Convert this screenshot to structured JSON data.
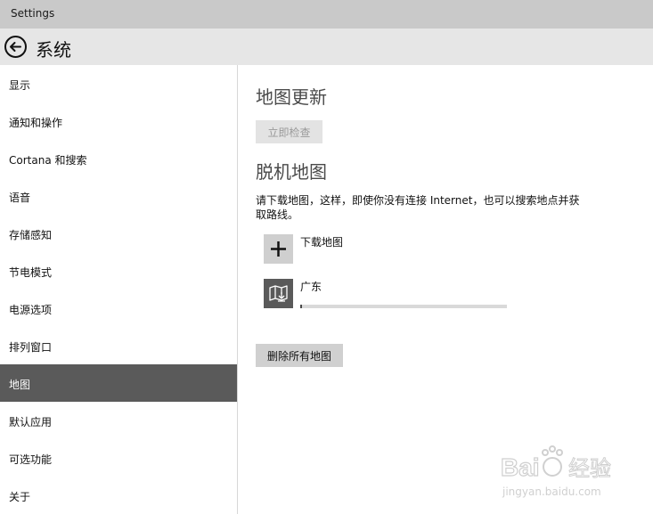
{
  "window": {
    "title": "Settings"
  },
  "header": {
    "title": "系统"
  },
  "sidebar": {
    "items": [
      {
        "label": "显示"
      },
      {
        "label": "通知和操作"
      },
      {
        "label": "Cortana 和搜索"
      },
      {
        "label": "语音"
      },
      {
        "label": "存储感知"
      },
      {
        "label": "节电模式"
      },
      {
        "label": "电源选项"
      },
      {
        "label": "排列窗口"
      },
      {
        "label": "地图",
        "selected": true
      },
      {
        "label": "默认应用"
      },
      {
        "label": "可选功能"
      },
      {
        "label": "关于"
      }
    ]
  },
  "main": {
    "map_updates": {
      "heading": "地图更新",
      "check_button": "立即检查"
    },
    "offline_maps": {
      "heading": "脱机地图",
      "description": "请下载地图，这样，即使你没有连接 Internet，也可以搜索地点并获取路线。",
      "download_label": "下载地图",
      "maps": [
        {
          "name": "广东",
          "progress": 0.01
        }
      ],
      "delete_all_button": "删除所有地图"
    }
  },
  "watermark": {
    "brand": "Baidu经验",
    "url": "jingyan.baidu.com"
  },
  "colors": {
    "titlebar": "#c9c9c9",
    "header": "#e6e6e6",
    "selected_nav": "#5a5a5a",
    "button_gray": "#d0d0d0"
  },
  "icons": {
    "back": "back-arrow-icon",
    "download": "plus-icon",
    "map": "map-download-icon"
  }
}
